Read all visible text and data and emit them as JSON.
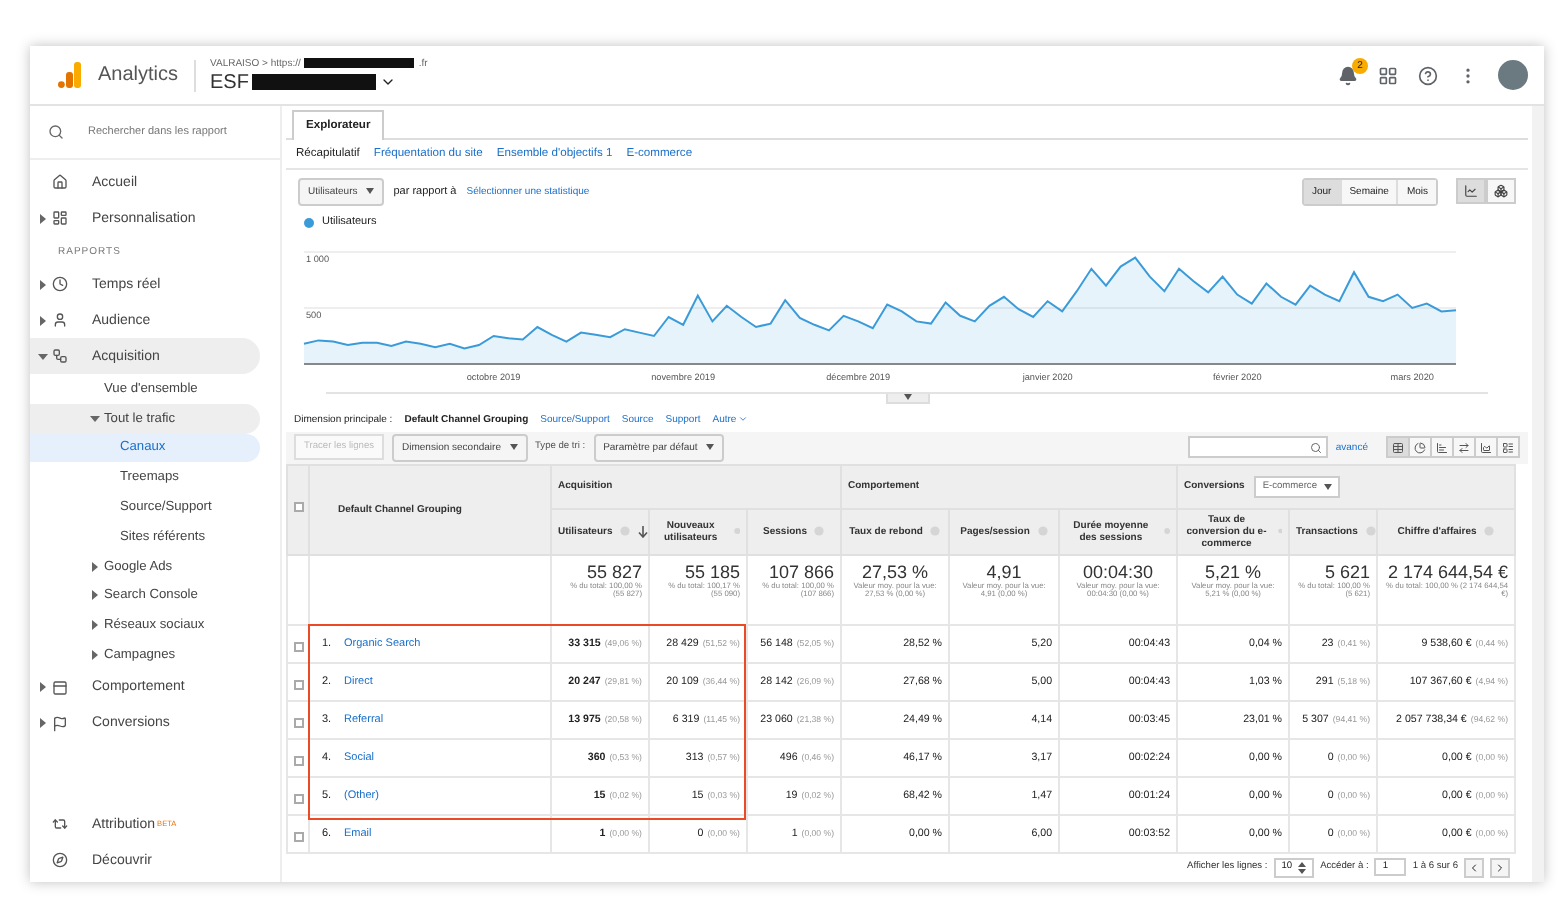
{
  "header": {
    "product": "Analytics",
    "account_path": "VALRAISO > https://",
    "account_suffix": ".fr",
    "property": "ESF",
    "notification_count": "2"
  },
  "sidebar": {
    "search": {
      "placeholder": "Rechercher dans les rapport"
    },
    "top_items": [
      {
        "label": "Accueil",
        "selected": false
      },
      {
        "label": "Personnalisation",
        "expanded": false,
        "selected": false
      }
    ],
    "section_title": "RAPPORTS",
    "report_items": [
      {
        "label": "Temps réel",
        "expanded": false,
        "selected": false
      },
      {
        "label": "Audience",
        "expanded": false,
        "selected": false
      },
      {
        "label": "Acquisition",
        "expanded": true,
        "selected": false,
        "children": [
          {
            "label": "Vue d'ensemble",
            "selected": false
          },
          {
            "label": "Tout le trafic",
            "expanded": true,
            "selected": false,
            "children": [
              {
                "label": "Canaux",
                "selected": true
              },
              {
                "label": "Treemaps",
                "selected": false
              },
              {
                "label": "Source/Support",
                "selected": false
              },
              {
                "label": "Sites référents",
                "selected": false
              }
            ]
          },
          {
            "label": "Google Ads",
            "expanded": false,
            "selected": false
          },
          {
            "label": "Search Console",
            "expanded": false,
            "selected": false
          },
          {
            "label": "Réseaux sociaux",
            "expanded": false,
            "selected": false
          },
          {
            "label": "Campagnes",
            "expanded": false,
            "selected": false
          }
        ]
      },
      {
        "label": "Comportement",
        "expanded": false,
        "selected": false
      },
      {
        "label": "Conversions",
        "expanded": false,
        "selected": false
      }
    ],
    "bottom_items": [
      {
        "label": "Attribution",
        "badge": "BETA",
        "selected": false
      },
      {
        "label": "Découvrir",
        "selected": false
      }
    ]
  },
  "explorer": {
    "tab": {
      "label": "Explorateur",
      "selected": true
    },
    "subtabs": [
      {
        "label": "Récapitulatif",
        "selected": true
      },
      {
        "label": "Fréquentation du site",
        "selected": false
      },
      {
        "label": "Ensemble d'objectifs 1",
        "selected": false
      },
      {
        "label": "E-commerce",
        "selected": false
      }
    ],
    "metric_select": "Utilisateurs",
    "compare_label": "par rapport à",
    "compare_link": "Sélectionner une statistique",
    "periods": [
      {
        "label": "Jour",
        "selected": true
      },
      {
        "label": "Semaine",
        "selected": false
      },
      {
        "label": "Mois",
        "selected": false
      }
    ],
    "chart_types": [
      {
        "selected": true
      },
      {
        "selected": false
      }
    ],
    "chart_data": {
      "type": "area",
      "ylim": [
        0,
        1000
      ],
      "categories": [
        null,
        null,
        null,
        null,
        null,
        null,
        null,
        null,
        null,
        null,
        null,
        null,
        null,
        "octobre 2019",
        null,
        null,
        null,
        null,
        null,
        null,
        null,
        null,
        null,
        null,
        null,
        null,
        "novembre 2019",
        null,
        null,
        null,
        null,
        null,
        null,
        null,
        null,
        null,
        null,
        null,
        "décembre 2019",
        null,
        null,
        null,
        null,
        null,
        null,
        null,
        null,
        null,
        null,
        null,
        null,
        "janvier 2020",
        null,
        null,
        null,
        null,
        null,
        null,
        null,
        null,
        null,
        null,
        null,
        null,
        "février 2020",
        null,
        null,
        null,
        null,
        null,
        null,
        null,
        null,
        null,
        null,
        null,
        "mars 2020",
        null,
        null,
        null
      ],
      "yticks": [
        {
          "value": 500,
          "label": "500"
        },
        {
          "value": 1000,
          "label": "1 000"
        }
      ],
      "series": [
        {
          "name": "Utilisateurs",
          "color": "#3b9bd9",
          "values": [
            180,
            210,
            200,
            170,
            190,
            190,
            160,
            200,
            180,
            150,
            180,
            140,
            170,
            250,
            230,
            220,
            330,
            260,
            200,
            280,
            260,
            240,
            310,
            280,
            250,
            420,
            350,
            610,
            380,
            520,
            420,
            330,
            360,
            570,
            410,
            350,
            300,
            430,
            380,
            320,
            530,
            470,
            380,
            360,
            550,
            430,
            380,
            520,
            600,
            490,
            420,
            560,
            470,
            650,
            850,
            700,
            870,
            950,
            780,
            650,
            850,
            740,
            640,
            780,
            620,
            540,
            720,
            600,
            530,
            700,
            620,
            560,
            820,
            600,
            560,
            620,
            500,
            540,
            470,
            480
          ]
        }
      ]
    }
  },
  "dimension": {
    "label": "Dimension principale :",
    "options": [
      {
        "label": "Default Channel Grouping",
        "kind": "option",
        "selected": true
      },
      {
        "label": "Source/Support",
        "kind": "option",
        "selected": false
      },
      {
        "label": "Source",
        "kind": "option",
        "selected": false
      },
      {
        "label": "Support",
        "kind": "option",
        "selected": false
      },
      {
        "label": "Autre",
        "kind": "menu",
        "selected": false
      }
    ]
  },
  "toolbar": {
    "plot_rows": {
      "label": "Tracer les lignes",
      "disabled": true
    },
    "secondary_dimension": "Dimension secondaire",
    "sort_label": "Type de tri :",
    "sort_select": "Paramètre par défaut",
    "advanced_link": "avancé",
    "views": [
      {
        "selected": true
      },
      {
        "selected": false
      },
      {
        "selected": false
      },
      {
        "selected": false
      },
      {
        "selected": false
      },
      {
        "selected": false
      }
    ]
  },
  "table": {
    "dimension_header": "Default Channel Grouping",
    "select_all_checked": false,
    "groups": [
      {
        "label": "Acquisition"
      },
      {
        "label": "Comportement"
      },
      {
        "label": "Conversions",
        "select": "E-commerce"
      }
    ],
    "columns": [
      {
        "label": "Utilisateurs",
        "help": true,
        "sorted": true
      },
      {
        "label": "Nouveaux utilisateurs",
        "help": true,
        "sorted": false
      },
      {
        "label": "Sessions",
        "help": true,
        "sorted": false
      },
      {
        "label": "Taux de rebond",
        "help": true,
        "sorted": false
      },
      {
        "label": "Pages/session",
        "help": true,
        "sorted": false
      },
      {
        "label": "Durée moyenne des sessions",
        "help": true,
        "sorted": false
      },
      {
        "label": "Taux de conversion du e-commerce",
        "help": true,
        "sorted": false
      },
      {
        "label": "Transactions",
        "help": true,
        "sorted": false
      },
      {
        "label": "Chiffre d'affaires",
        "help": true,
        "sorted": false
      }
    ],
    "totals": [
      {
        "value": "55 827",
        "note": "% du total: 100,00 % (55 827)"
      },
      {
        "value": "55 185",
        "note": "% du total: 100,17 % (55 090)"
      },
      {
        "value": "107 866",
        "note": "% du total: 100,00 % (107 866)"
      },
      {
        "value": "27,53 %",
        "note": "Valeur moy. pour la vue: 27,53 % (0,00 %)"
      },
      {
        "value": "4,91",
        "note": "Valeur moy. pour la vue: 4,91 (0,00 %)"
      },
      {
        "value": "00:04:30",
        "note": "Valeur moy. pour la vue: 00:04:30 (0,00 %)"
      },
      {
        "value": "5,21 %",
        "note": "Valeur moy. pour la vue: 5,21 % (0,00 %)"
      },
      {
        "value": "5 621",
        "note": "% du total: 100,00 % (5 621)"
      },
      {
        "value": "2 174 644,54 €",
        "note": "% du total: 100,00 % (2 174 644,54 €)"
      }
    ],
    "rows": [
      {
        "rank": "1.",
        "name": "Organic Search",
        "checked": false,
        "cells": [
          {
            "value": "33 315",
            "share": "(49,06 %)"
          },
          {
            "value": "28 429",
            "share": "(51,52 %)"
          },
          {
            "value": "56 148",
            "share": "(52,05 %)"
          },
          {
            "value": "28,52 %"
          },
          {
            "value": "5,20"
          },
          {
            "value": "00:04:43"
          },
          {
            "value": "0,04 %"
          },
          {
            "value": "23",
            "share": "(0,41 %)"
          },
          {
            "value": "9 538,60 €",
            "share": "(0,44 %)"
          }
        ]
      },
      {
        "rank": "2.",
        "name": "Direct",
        "checked": false,
        "cells": [
          {
            "value": "20 247",
            "share": "(29,81 %)"
          },
          {
            "value": "20 109",
            "share": "(36,44 %)"
          },
          {
            "value": "28 142",
            "share": "(26,09 %)"
          },
          {
            "value": "27,68 %"
          },
          {
            "value": "5,00"
          },
          {
            "value": "00:04:43"
          },
          {
            "value": "1,03 %"
          },
          {
            "value": "291",
            "share": "(5,18 %)"
          },
          {
            "value": "107 367,60 €",
            "share": "(4,94 %)"
          }
        ]
      },
      {
        "rank": "3.",
        "name": "Referral",
        "checked": false,
        "cells": [
          {
            "value": "13 975",
            "share": "(20,58 %)"
          },
          {
            "value": "6 319",
            "share": "(11,45 %)"
          },
          {
            "value": "23 060",
            "share": "(21,38 %)"
          },
          {
            "value": "24,49 %"
          },
          {
            "value": "4,14"
          },
          {
            "value": "00:03:45"
          },
          {
            "value": "23,01 %"
          },
          {
            "value": "5 307",
            "share": "(94,41 %)"
          },
          {
            "value": "2 057 738,34 €",
            "share": "(94,62 %)"
          }
        ]
      },
      {
        "rank": "4.",
        "name": "Social",
        "checked": false,
        "cells": [
          {
            "value": "360",
            "share": "(0,53 %)"
          },
          {
            "value": "313",
            "share": "(0,57 %)"
          },
          {
            "value": "496",
            "share": "(0,46 %)"
          },
          {
            "value": "46,17 %"
          },
          {
            "value": "3,17"
          },
          {
            "value": "00:02:24"
          },
          {
            "value": "0,00 %"
          },
          {
            "value": "0",
            "share": "(0,00 %)"
          },
          {
            "value": "0,00 €",
            "share": "(0,00 %)"
          }
        ]
      },
      {
        "rank": "5.",
        "name": "(Other)",
        "checked": false,
        "cells": [
          {
            "value": "15",
            "share": "(0,02 %)"
          },
          {
            "value": "15",
            "share": "(0,03 %)"
          },
          {
            "value": "19",
            "share": "(0,02 %)"
          },
          {
            "value": "68,42 %"
          },
          {
            "value": "1,47"
          },
          {
            "value": "00:01:24"
          },
          {
            "value": "0,00 %"
          },
          {
            "value": "0",
            "share": "(0,00 %)"
          },
          {
            "value": "0,00 €",
            "share": "(0,00 %)"
          }
        ]
      },
      {
        "rank": "6.",
        "name": "Email",
        "checked": false,
        "cells": [
          {
            "value": "1",
            "share": "(0,00 %)"
          },
          {
            "value": "0",
            "share": "(0,00 %)"
          },
          {
            "value": "1",
            "share": "(0,00 %)"
          },
          {
            "value": "0,00 %"
          },
          {
            "value": "6,00"
          },
          {
            "value": "00:03:52"
          },
          {
            "value": "0,00 %"
          },
          {
            "value": "0",
            "share": "(0,00 %)"
          },
          {
            "value": "0,00 €",
            "share": "(0,00 %)"
          }
        ]
      }
    ]
  },
  "pagination": {
    "rows_label": "Afficher les lignes :",
    "rows_value": "10",
    "goto_label": "Accéder à :",
    "goto_value": "1",
    "range": "1 à 6 sur 6"
  }
}
